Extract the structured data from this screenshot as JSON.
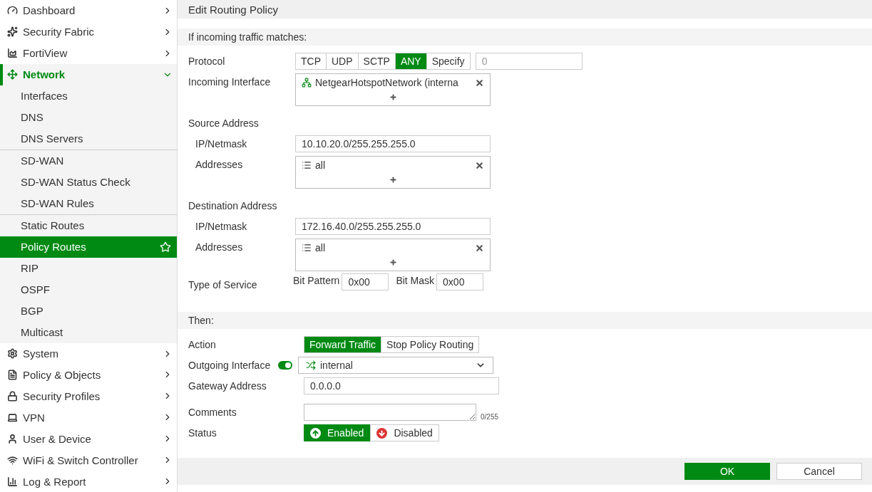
{
  "sidebar": {
    "items": [
      {
        "label": "Dashboard",
        "expanded": false
      },
      {
        "label": "Security Fabric",
        "expanded": false
      },
      {
        "label": "FortiView",
        "expanded": false
      },
      {
        "label": "Network",
        "expanded": true,
        "groups": [
          {
            "children": [
              {
                "label": "Interfaces",
                "selected": false
              },
              {
                "label": "DNS",
                "selected": false
              },
              {
                "label": "DNS Servers",
                "selected": false
              }
            ]
          },
          {
            "children": [
              {
                "label": "SD-WAN",
                "selected": false
              },
              {
                "label": "SD-WAN Status Check",
                "selected": false
              },
              {
                "label": "SD-WAN Rules",
                "selected": false
              }
            ]
          },
          {
            "children": [
              {
                "label": "Static Routes",
                "selected": false
              },
              {
                "label": "Policy Routes",
                "selected": true
              },
              {
                "label": "RIP",
                "selected": false
              },
              {
                "label": "OSPF",
                "selected": false
              },
              {
                "label": "BGP",
                "selected": false
              },
              {
                "label": "Multicast",
                "selected": false
              }
            ]
          }
        ]
      },
      {
        "label": "System",
        "expanded": false
      },
      {
        "label": "Policy & Objects",
        "expanded": false
      },
      {
        "label": "Security Profiles",
        "expanded": false
      },
      {
        "label": "VPN",
        "expanded": false
      },
      {
        "label": "User & Device",
        "expanded": false
      },
      {
        "label": "WiFi & Switch Controller",
        "expanded": false
      },
      {
        "label": "Log & Report",
        "expanded": false
      }
    ]
  },
  "title": "Edit Routing Policy",
  "match": {
    "title": "If incoming traffic matches:",
    "protocol": {
      "label": "Protocol",
      "options": [
        {
          "label": "TCP",
          "selected": false
        },
        {
          "label": "UDP",
          "selected": false
        },
        {
          "label": "SCTP",
          "selected": false
        },
        {
          "label": "ANY",
          "selected": true
        },
        {
          "label": "Specify",
          "selected": false
        }
      ],
      "placeholder": "0"
    },
    "incoming_interface": {
      "label": "Incoming Interface",
      "entries": [
        "NetgearHotspotNetwork (interna"
      ]
    },
    "source": {
      "label": "Source Address",
      "ip": {
        "label": "IP/Netmask",
        "value": "10.10.20.0/255.255.255.0"
      },
      "addresses": {
        "label": "Addresses",
        "entries": [
          "all"
        ]
      }
    },
    "destination": {
      "label": "Destination Address",
      "ip": {
        "label": "IP/Netmask",
        "value": "172.16.40.0/255.255.255.0"
      },
      "addresses": {
        "label": "Addresses",
        "entries": [
          "all"
        ]
      }
    },
    "tos": {
      "label": "Type of Service",
      "bit_pattern": {
        "label": "Bit Pattern",
        "value": "0x00"
      },
      "bit_mask": {
        "label": "Bit Mask",
        "value": "0x00"
      }
    }
  },
  "then": {
    "title": "Then:",
    "action": {
      "label": "Action",
      "options": [
        {
          "label": "Forward Traffic",
          "selected": true
        },
        {
          "label": "Stop Policy Routing",
          "selected": false
        }
      ]
    },
    "outgoing": {
      "label": "Outgoing Interface",
      "on": true,
      "value": "internal"
    },
    "gateway": {
      "label": "Gateway Address",
      "value": "0.0.0.0"
    },
    "comments": {
      "label": "Comments",
      "counter": "0/255"
    },
    "status": {
      "label": "Status",
      "options": [
        {
          "label": "Enabled",
          "selected": true
        },
        {
          "label": "Disabled",
          "selected": false
        }
      ]
    }
  },
  "buttons": [
    {
      "label": "OK",
      "kind": "primary"
    },
    {
      "label": "Cancel",
      "kind": "secondary"
    }
  ]
}
